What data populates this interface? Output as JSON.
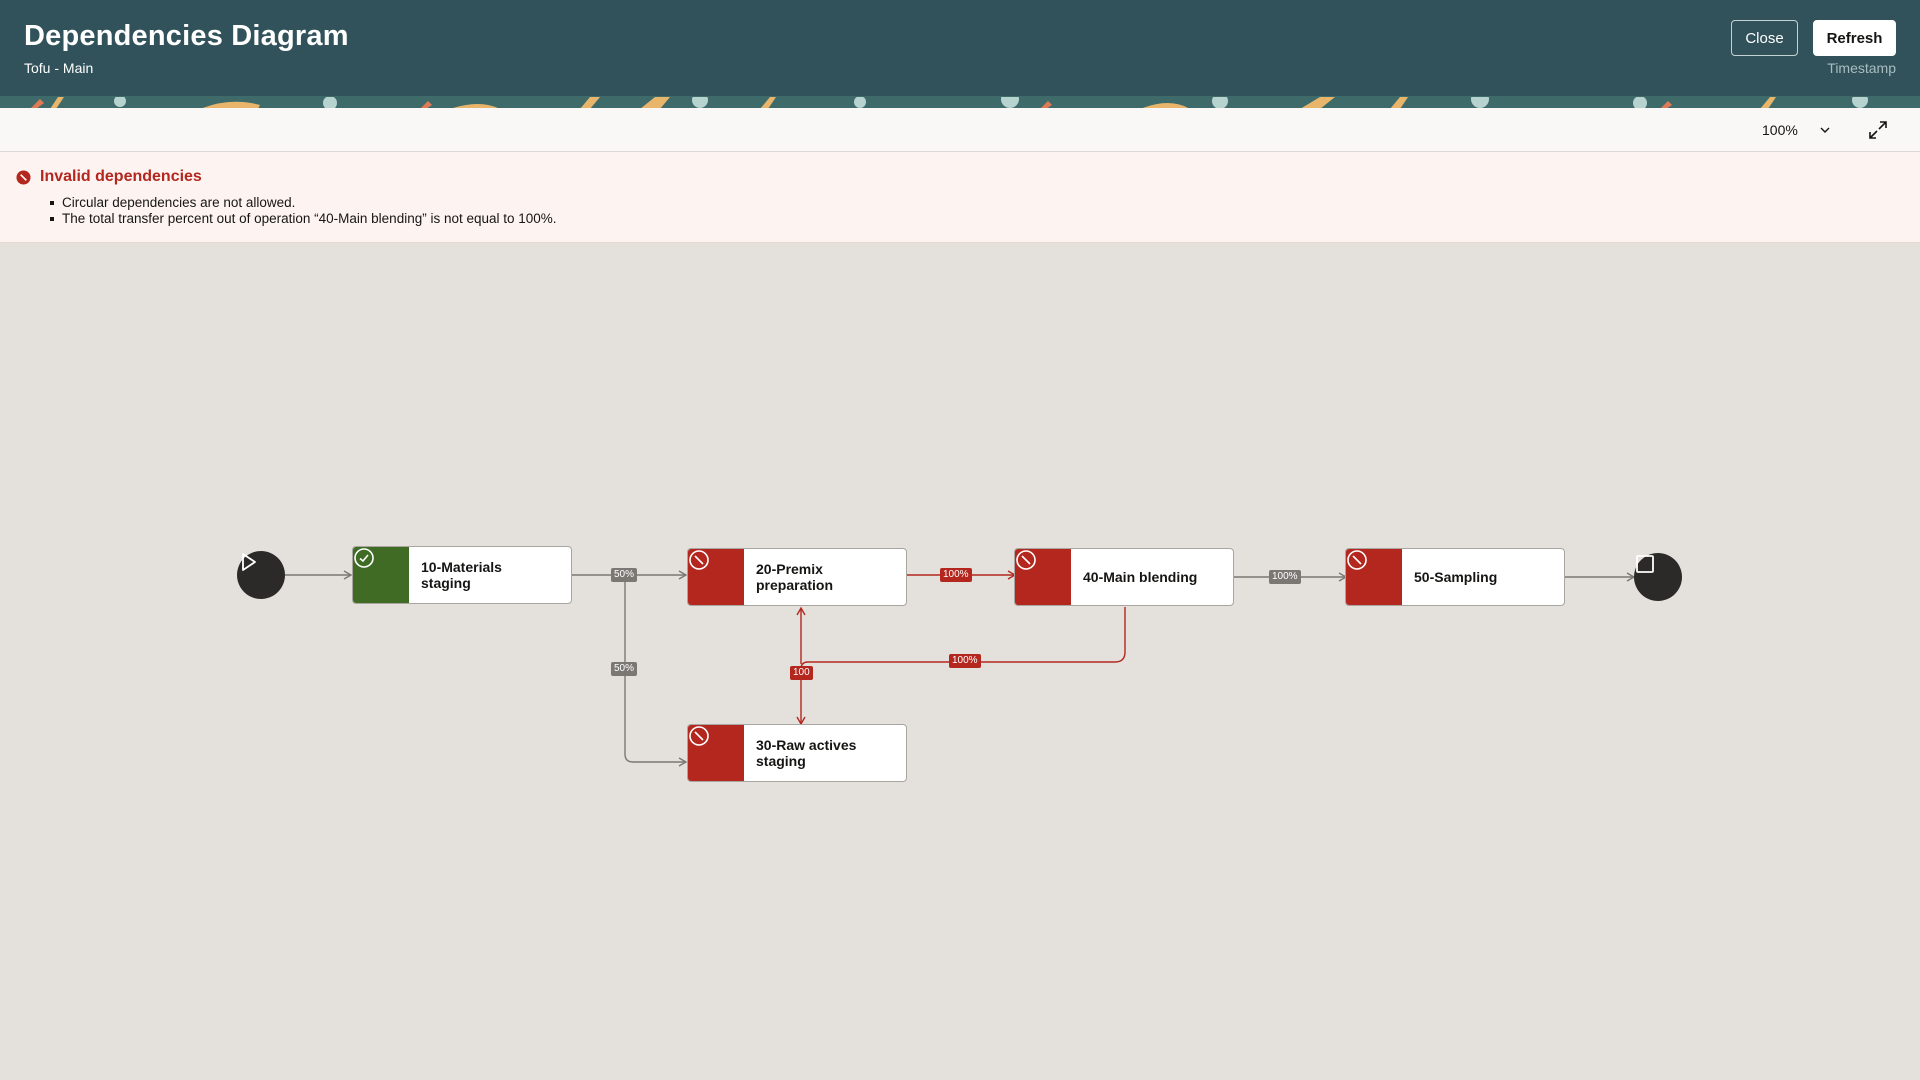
{
  "header": {
    "title": "Dependencies Diagram",
    "subtitle": "Tofu - Main",
    "close_label": "Close",
    "refresh_label": "Refresh",
    "timestamp_label": "Timestamp"
  },
  "toolbar": {
    "zoom_value": "100%"
  },
  "error": {
    "title": "Invalid dependencies",
    "messages": [
      "Circular dependencies are not allowed.",
      "The total transfer percent out of operation “40-Main blending” is not equal to 100%."
    ]
  },
  "diagram": {
    "nodes": [
      {
        "id": "10",
        "label_line1": "10-Materials",
        "label_line2": "staging",
        "status": "valid"
      },
      {
        "id": "20",
        "label_line1": "20-Premix",
        "label_line2": "preparation",
        "status": "invalid"
      },
      {
        "id": "30",
        "label_line1": "30-Raw actives",
        "label_line2": "staging",
        "status": "invalid"
      },
      {
        "id": "40",
        "label_line1": "40-Main blending",
        "label_line2": "",
        "status": "invalid"
      },
      {
        "id": "50",
        "label_line1": "50-Sampling",
        "label_line2": "",
        "status": "invalid"
      }
    ],
    "edge_labels": {
      "e10_20": "50%",
      "e10_30": "50%",
      "e20_40": "100%",
      "e40_50": "100%",
      "e40_30": "100%",
      "e20_30": "100"
    },
    "colors": {
      "valid": "#3f6b25",
      "invalid": "#b3271e",
      "edge_gray": "#7b7874",
      "edge_red": "#b3271e"
    },
    "icons": {
      "start": "play-icon",
      "end": "stop-icon",
      "valid": "check-circle-icon",
      "invalid": "blocked-icon"
    }
  }
}
